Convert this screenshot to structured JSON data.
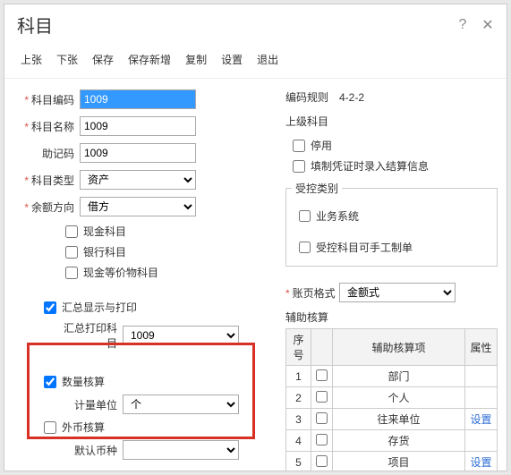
{
  "title": "科目",
  "toolbar": {
    "prev": "上张",
    "next": "下张",
    "save": "保存",
    "save_new": "保存新增",
    "copy": "复制",
    "settings": "设置",
    "exit": "退出"
  },
  "left": {
    "code_label": "科目编码",
    "code_value": "1009",
    "name_label": "科目名称",
    "name_value": "1009",
    "mnemonic_label": "助记码",
    "mnemonic_value": "1009",
    "type_label": "科目类型",
    "type_value": "资产",
    "balance_label": "余额方向",
    "balance_value": "借方",
    "cash_label": "现金科目",
    "bank_label": "银行科目",
    "equiv_label": "现金等价物科目",
    "summary_print_label": "汇总显示与打印",
    "summary_subj_label": "汇总打印科目",
    "summary_subj_value": "1009",
    "qty_label": "数量核算",
    "unit_label": "计量单位",
    "unit_value": "个",
    "foreign_label": "外币核算",
    "default_currency_label": "默认币种"
  },
  "right": {
    "rule_label": "编码规则",
    "rule_value": "4-2-2",
    "parent_label": "上级科目",
    "disable_label": "停用",
    "voucher_info_label": "填制凭证时录入结算信息",
    "controlled_legend": "受控类别",
    "biz_system_label": "业务系统",
    "manual_voucher_label": "受控科目可手工制单",
    "page_fmt_label": "账页格式",
    "page_fmt_value": "金额式",
    "aux_title": "辅助核算",
    "aux_headers": {
      "seq": "序号",
      "chk": "",
      "item": "辅助核算项",
      "attr": "属性"
    },
    "aux_rows": [
      {
        "seq": "1",
        "item": "部门",
        "attr": ""
      },
      {
        "seq": "2",
        "item": "个人",
        "attr": ""
      },
      {
        "seq": "3",
        "item": "往来单位",
        "attr": "设置"
      },
      {
        "seq": "4",
        "item": "存货",
        "attr": ""
      },
      {
        "seq": "5",
        "item": "项目",
        "attr": "设置"
      }
    ]
  }
}
